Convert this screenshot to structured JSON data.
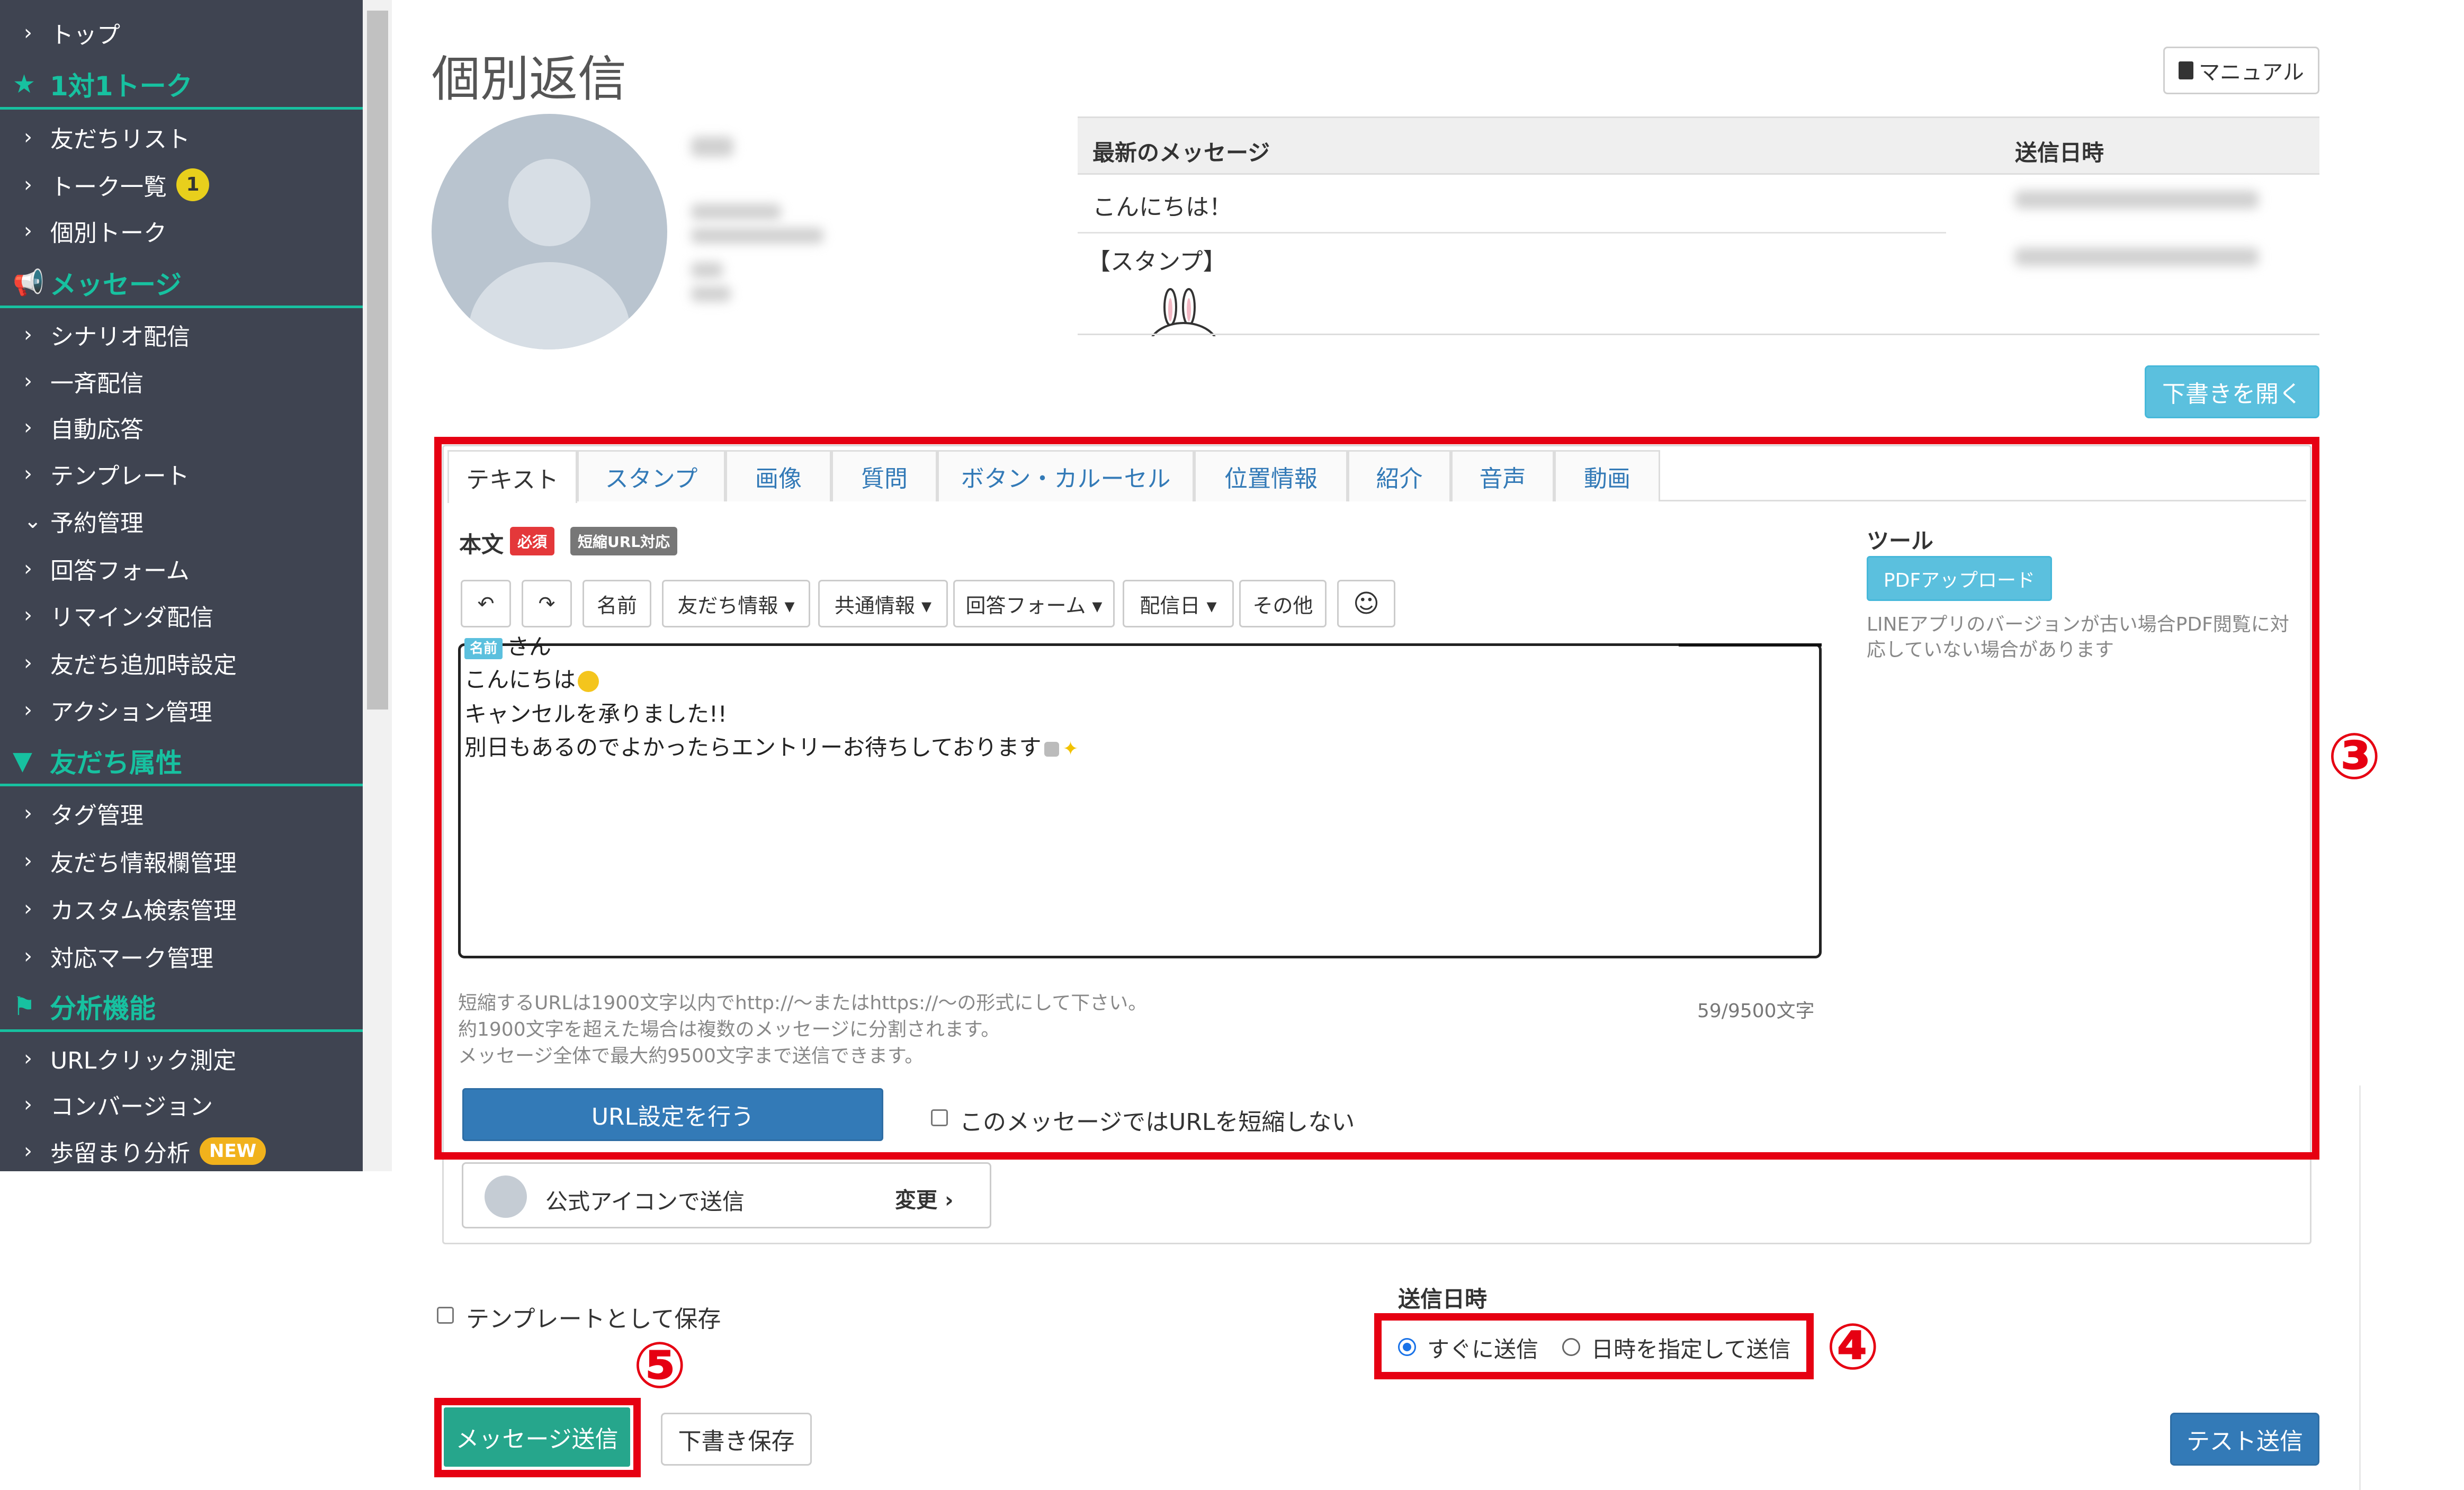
{
  "sidebar": {
    "items": [
      {
        "type": "item",
        "label": "トップ"
      },
      {
        "type": "head",
        "label": "1対1トーク",
        "icon": "star-icon"
      },
      {
        "type": "item",
        "label": "友だちリスト"
      },
      {
        "type": "item",
        "label": "トーク一覧",
        "badge": "1"
      },
      {
        "type": "item",
        "label": "個別トーク"
      },
      {
        "type": "head",
        "label": "メッセージ",
        "icon": "megaphone-icon"
      },
      {
        "type": "item",
        "label": "シナリオ配信"
      },
      {
        "type": "item",
        "label": "一斉配信"
      },
      {
        "type": "item",
        "label": "自動応答"
      },
      {
        "type": "item",
        "label": "テンプレート"
      },
      {
        "type": "item",
        "label": "予約管理",
        "expanded": true
      },
      {
        "type": "item",
        "label": "回答フォーム"
      },
      {
        "type": "item",
        "label": "リマインダ配信"
      },
      {
        "type": "item",
        "label": "友だち追加時設定"
      },
      {
        "type": "item",
        "label": "アクション管理"
      },
      {
        "type": "head",
        "label": "友だち属性",
        "icon": "filter-icon"
      },
      {
        "type": "item",
        "label": "タグ管理"
      },
      {
        "type": "item",
        "label": "友だち情報欄管理"
      },
      {
        "type": "item",
        "label": "カスタム検索管理"
      },
      {
        "type": "item",
        "label": "対応マーク管理"
      },
      {
        "type": "head",
        "label": "分析機能",
        "icon": "flag-icon"
      },
      {
        "type": "item",
        "label": "URLクリック測定"
      },
      {
        "type": "item",
        "label": "コンバージョン"
      },
      {
        "type": "item",
        "label": "歩留まり分析",
        "new_badge": "NEW"
      }
    ]
  },
  "header": {
    "title": "個別返信",
    "manual_label": "マニュアル"
  },
  "recent_messages": {
    "col_message": "最新のメッセージ",
    "col_sent": "送信日時",
    "rows": [
      {
        "message": "こんにちは！"
      },
      {
        "message": "【スタンプ】"
      }
    ]
  },
  "draft_open_label": "下書きを開く",
  "editor": {
    "tabs": [
      "テキスト",
      "スタンプ",
      "画像",
      "質問",
      "ボタン・カルーセル",
      "位置情報",
      "紹介",
      "音声",
      "動画"
    ],
    "active_tab": "テキスト",
    "body_label": "本文",
    "required_badge": "必須",
    "shorturl_badge": "短縮URL対応",
    "toolbar": {
      "undo": "↶",
      "redo": "↷",
      "name": "名前",
      "friend_info": "友だち情報 ▾",
      "common_info": "共通情報 ▾",
      "answer_form": "回答フォーム ▾",
      "delivery_date": "配信日 ▾",
      "other": "その他",
      "emoji": "☺"
    },
    "text_lines": {
      "name_chip": "名前",
      "line1_suffix": "さん",
      "line2": "こんにちは",
      "line3": "キャンセルを承りました!!",
      "line4": "別日もあるのでよかったらエントリーお待ちしております"
    },
    "notes": [
      "短縮するURLは1900文字以内でhttp://〜またはhttps://〜の形式にして下さい。",
      "約1900文字を超えた場合は複数のメッセージに分割されます。",
      "メッセージ全体で最大約9500文字まで送信できます。"
    ],
    "char_count": "59/9500文字",
    "url_setting_button": "URL設定を行う",
    "no_shorten_label": "このメッセージではURLを短縮しない",
    "tools_label": "ツール",
    "pdf_upload_button": "PDFアップロード",
    "pdf_note_1": "LINEアプリのバージョンが古い場合PDF閲覧に対",
    "pdf_note_2": "応していない場合があります"
  },
  "sender": {
    "label": "公式アイコンで送信",
    "change": "変更"
  },
  "save_template_label": "テンプレートとして保存",
  "send_time": {
    "label": "送信日時",
    "option_now": "すぐに送信",
    "option_scheduled": "日時を指定して送信",
    "selected": "すぐに送信"
  },
  "buttons": {
    "send": "メッセージ送信",
    "save_draft": "下書き保存",
    "test_send": "テスト送信"
  },
  "callouts": {
    "three": "③",
    "four": "④",
    "five": "⑤"
  },
  "colors": {
    "sidebar_bg": "#3f4451",
    "sidebar_accent": "#17c1a0",
    "highlight_red": "#e60012",
    "primary_blue": "#337ab7",
    "info_blue": "#5bc0de",
    "send_green": "#26a68c"
  }
}
